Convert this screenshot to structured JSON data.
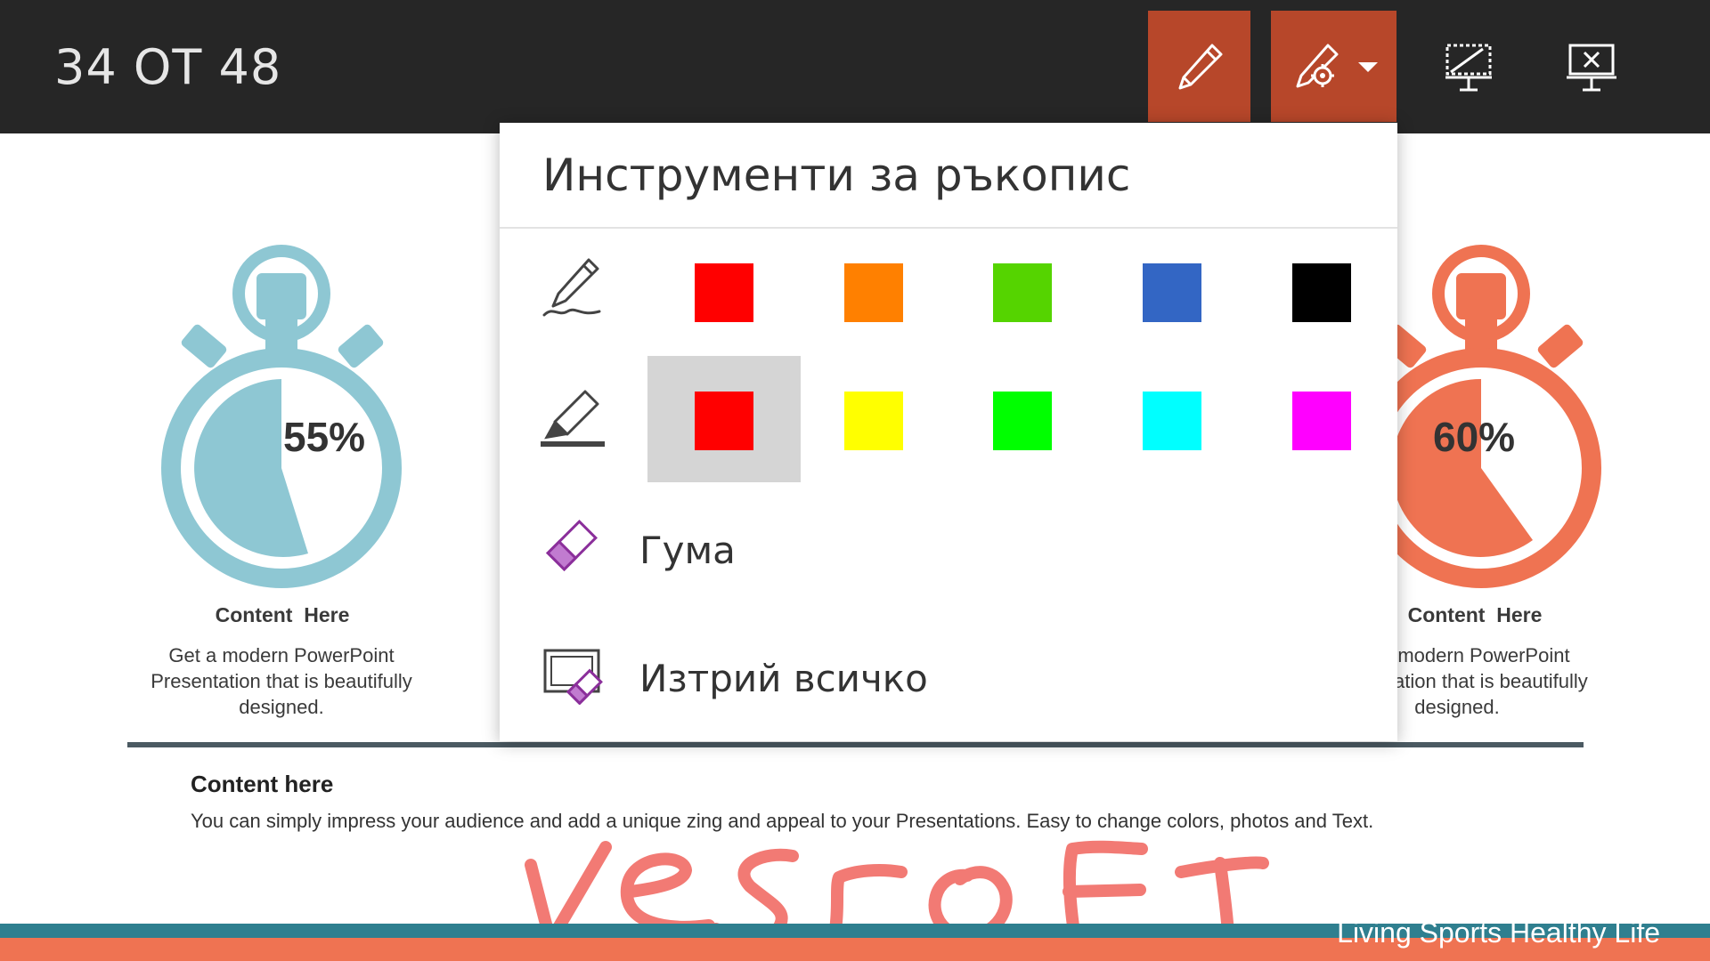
{
  "topbar": {
    "slide_counter": "34 ОТ 48",
    "buttons": [
      {
        "name": "pen-button",
        "icon": "pen-icon",
        "active": true
      },
      {
        "name": "ink-tools-button",
        "icon": "pen-settings-icon",
        "active": true
      },
      {
        "name": "screen-button",
        "icon": "screen-icon",
        "active": false
      },
      {
        "name": "end-show-button",
        "icon": "end-show-icon",
        "active": false
      }
    ]
  },
  "slide": {
    "left": {
      "percent": "55%",
      "title": "Content  Here",
      "text": "Get a modern PowerPoint Presentation that is beautifully designed.",
      "color": "#8ec7d3"
    },
    "right": {
      "percent": "60%",
      "title": "Content  Here",
      "text": "Get a modern PowerPoint Presentation that is beautifully designed.",
      "color": "#ef7352"
    },
    "bottom_title": "Content here",
    "bottom_text": "You can simply impress your audience and add a unique zing and appeal to your Presentations. Easy to change colors, photos and Text.",
    "footer": "Living Sports Healthy Life",
    "ink_text": "vesroft",
    "ink_color": "#f27a74"
  },
  "ink_tools": {
    "title": "Инструменти за ръкопис",
    "pen_colors": [
      "#ff0000",
      "#ff8000",
      "#55d400",
      "#3366c4",
      "#000000"
    ],
    "highlighter_colors": [
      "#ff0000",
      "#ffff00",
      "#00ff00",
      "#00ffff",
      "#ff00ff"
    ],
    "selected_highlighter_index": 0,
    "eraser_label": "Гума",
    "clear_all_label": "Изтрий всичко"
  }
}
